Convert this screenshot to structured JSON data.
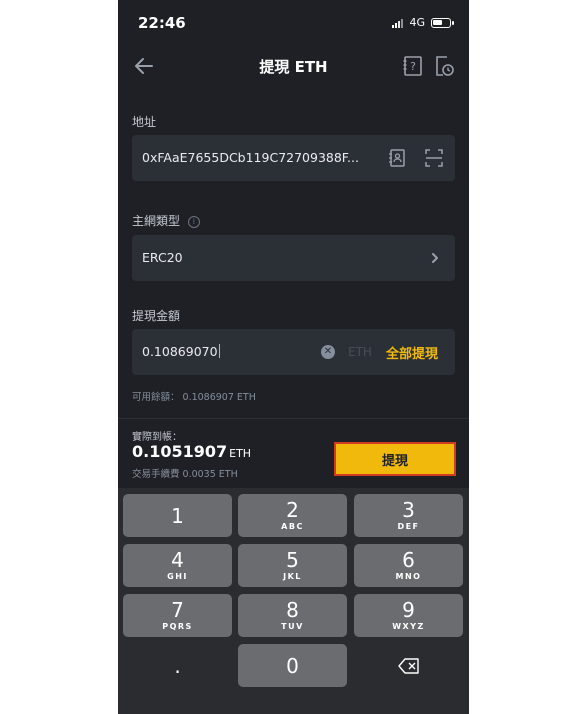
{
  "status_bar": {
    "time": "22:46",
    "network": "4G"
  },
  "header": {
    "title": "提現 ETH",
    "back_icon": "arrow-left-icon",
    "help_icon": "help-document-icon",
    "history_icon": "history-icon"
  },
  "address": {
    "label": "地址",
    "value": "0xFAaE7655DCb119C72709388F..."
  },
  "network": {
    "label": "主網類型",
    "value": "ERC20"
  },
  "amount": {
    "label": "提現金額",
    "value": "0.10869070",
    "unit": "ETH",
    "max_label": "全部提現"
  },
  "available": {
    "text": "可用餘額： 0.1086907 ETH"
  },
  "summary": {
    "receive_label": "實際到帳：",
    "receive_amount": "0.1051907",
    "receive_unit": "ETH",
    "fee_text": "交易手續費 0.0035 ETH",
    "withdraw_button": "提現"
  },
  "keypad": {
    "keys": [
      {
        "num": "1",
        "letters": ""
      },
      {
        "num": "2",
        "letters": "ABC"
      },
      {
        "num": "3",
        "letters": "DEF"
      },
      {
        "num": "4",
        "letters": "GHI"
      },
      {
        "num": "5",
        "letters": "JKL"
      },
      {
        "num": "6",
        "letters": "MNO"
      },
      {
        "num": "7",
        "letters": "PQRS"
      },
      {
        "num": "8",
        "letters": "TUV"
      },
      {
        "num": "9",
        "letters": "WXYZ"
      },
      {
        "num": ".",
        "letters": ""
      },
      {
        "num": "0",
        "letters": ""
      }
    ]
  },
  "colors": {
    "background": "#1e2026",
    "field": "#2b2f36",
    "accent": "#f0b90b",
    "keypad": "#2b2c2f",
    "key": "#6b6c70"
  }
}
